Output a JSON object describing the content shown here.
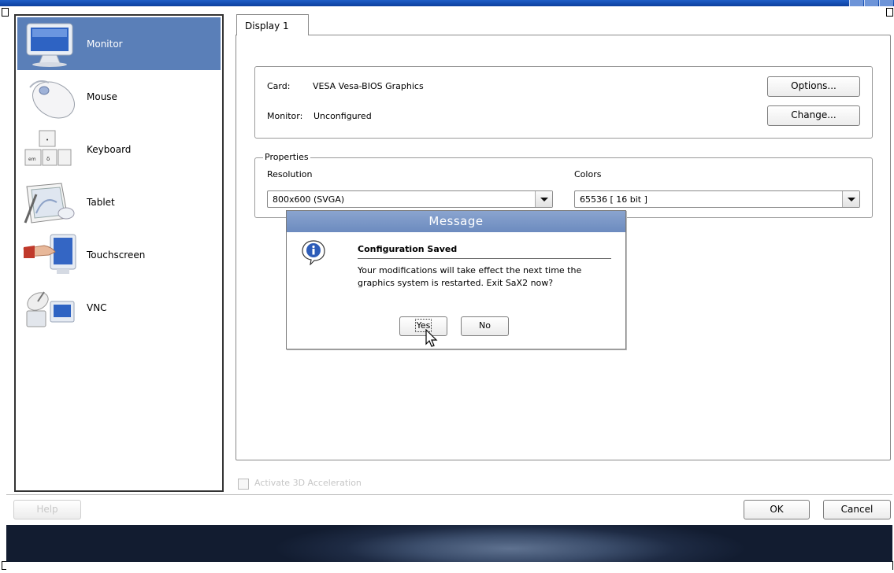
{
  "sidebar": {
    "items": [
      {
        "label": "Monitor",
        "icon": "monitor-icon",
        "selected": true
      },
      {
        "label": "Mouse",
        "icon": "mouse-icon",
        "selected": false
      },
      {
        "label": "Keyboard",
        "icon": "keyboard-icon",
        "selected": false
      },
      {
        "label": "Tablet",
        "icon": "tablet-icon",
        "selected": false
      },
      {
        "label": "Touchscreen",
        "icon": "touchscreen-icon",
        "selected": false
      },
      {
        "label": "VNC",
        "icon": "vnc-icon",
        "selected": false
      }
    ]
  },
  "tabs": [
    {
      "label": "Display 1",
      "active": true
    }
  ],
  "card": {
    "card_label": "Card:",
    "card_value": "VESA Vesa-BIOS Graphics",
    "monitor_label": "Monitor:",
    "monitor_value": "Unconfigured",
    "options_button": "Options...",
    "change_button": "Change..."
  },
  "properties": {
    "title": "Properties",
    "resolution_label": "Resolution",
    "resolution_value": "800x600 (SVGA)",
    "colors_label": "Colors",
    "colors_value": "65536 [ 16 bit ]"
  },
  "accel_checkbox": {
    "label": "Activate 3D Acceleration",
    "checked": false,
    "enabled": false
  },
  "footer": {
    "help": "Help",
    "ok": "OK",
    "cancel": "Cancel"
  },
  "dialog": {
    "title": "Message",
    "icon": "info-icon",
    "heading": "Configuration Saved",
    "message": "Your modifications will take effect the next time the graphics system is restarted. Exit SaX2 now?",
    "yes": "Yes",
    "no": "No"
  },
  "colors": {
    "selection": "#5a7fb8",
    "title_bar": "#7592c4",
    "window_top": "#1f5fc8"
  }
}
